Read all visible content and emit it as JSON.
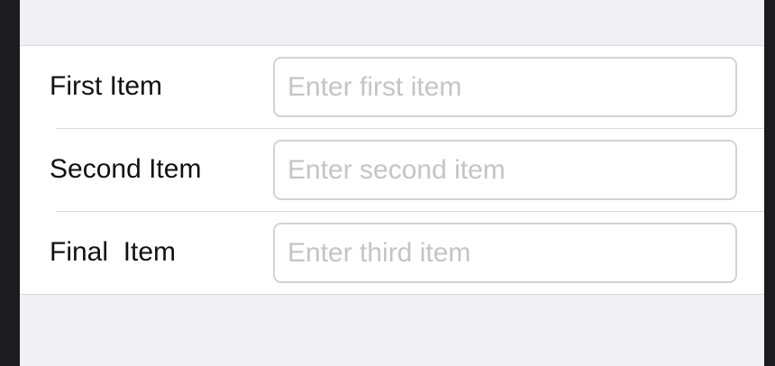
{
  "form": {
    "rows": [
      {
        "label": "First Item",
        "placeholder": "Enter first item",
        "value": ""
      },
      {
        "label": "Second Item",
        "placeholder": "Enter second item",
        "value": ""
      },
      {
        "label": "Final  Item",
        "placeholder": "Enter third item",
        "value": ""
      }
    ]
  },
  "colors": {
    "background": "#efeff4",
    "group_background": "#ffffff",
    "separator": "#d9d9de",
    "label_text": "#111111",
    "placeholder_text": "#c4c4c9",
    "input_border": "#d3d3d6"
  }
}
